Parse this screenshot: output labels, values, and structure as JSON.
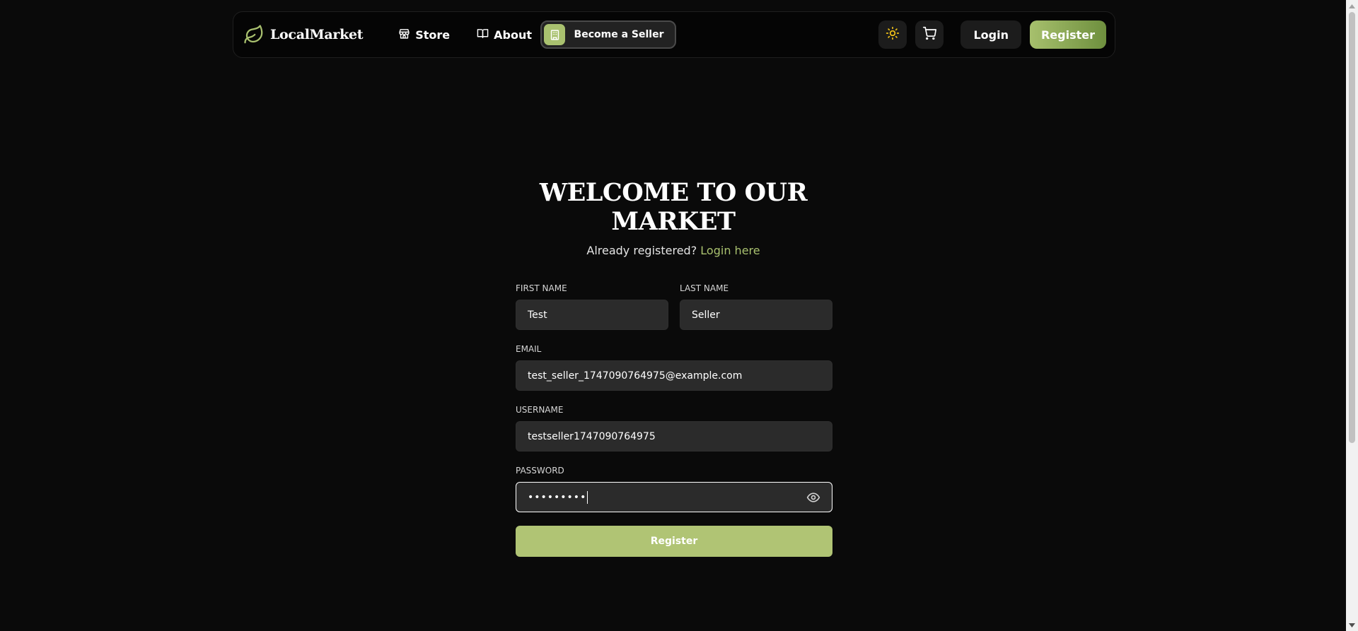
{
  "navbar": {
    "brand": "LocalMarket",
    "links": [
      {
        "label": "Store",
        "icon": "store-icon"
      },
      {
        "label": "About",
        "icon": "book-icon"
      }
    ],
    "become_seller": "Become a Seller",
    "login": "Login",
    "register": "Register",
    "theme_icon": "sun-icon",
    "cart_icon": "cart-icon"
  },
  "form": {
    "title": "WELCOME TO OUR MARKET",
    "subtitle_prefix": "Already registered?",
    "subtitle_link": "Login here",
    "first_name_label": "FIRST NAME",
    "first_name_value": "Test",
    "last_name_label": "LAST NAME",
    "last_name_value": "Seller",
    "email_label": "EMAIL",
    "email_value": "test_seller_1747090764975@example.com",
    "username_label": "USERNAME",
    "username_value": "testseller1747090764975",
    "password_label": "PASSWORD",
    "password_masked": "•••••••••",
    "submit": "Register"
  },
  "colors": {
    "accent": "#a9c16f",
    "background": "#0a0a0a",
    "input_bg": "#2b2b2b",
    "sun": "#f5c518"
  }
}
